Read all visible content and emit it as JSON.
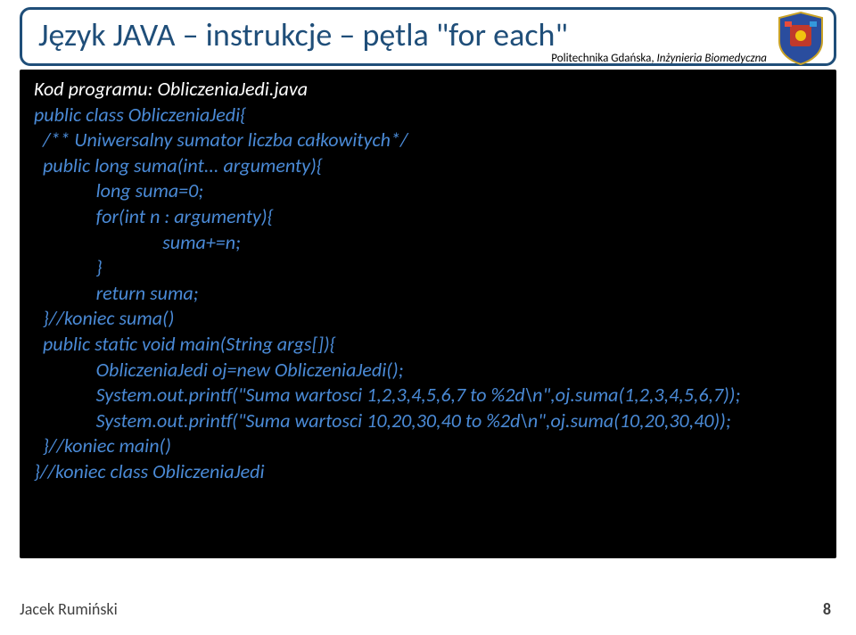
{
  "title": "Język JAVA – instrukcje – pętla \"for each\"",
  "subheader_plain": "Politechnika Gdańska, ",
  "subheader_italic": "Inżynieria Biomedyczna",
  "code": {
    "l1": "Kod programu: ObliczeniaJedi.java",
    "l2": "",
    "l3": "public class ObliczeniaJedi{",
    "l4": "",
    "l5": "  /** Uniwersalny sumator liczba całkowitych*/",
    "l6": "  public long suma(int... argumenty){",
    "l7": "              long suma=0;",
    "l8": "              for(int n : argumenty){",
    "l9": "                             suma+=n;",
    "l10": "              }",
    "l11": "              return suma;",
    "l12": "  }//koniec suma()",
    "l13": "",
    "l14": "  public static void main(String args[]){",
    "l15": "              ObliczeniaJedi oj=new ObliczeniaJedi();",
    "l16": "              System.out.printf(\"Suma wartosci 1,2,3,4,5,6,7 to %2d\\n\",oj.suma(1,2,3,4,5,6,7));",
    "l17": "              System.out.printf(\"Suma wartosci 10,20,30,40 to %2d\\n\",oj.suma(10,20,30,40));",
    "l18": "  }//koniec main()",
    "l19": "}//koniec class ObliczeniaJedi"
  },
  "footer_name": "Jacek Rumiński",
  "page_number": "8"
}
